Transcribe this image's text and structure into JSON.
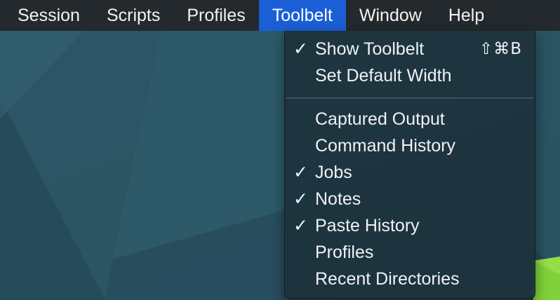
{
  "menubar": {
    "items": [
      {
        "label": "Session"
      },
      {
        "label": "Scripts"
      },
      {
        "label": "Profiles"
      },
      {
        "label": "Toolbelt",
        "active": true
      },
      {
        "label": "Window"
      },
      {
        "label": "Help"
      }
    ]
  },
  "toolbelt_menu": {
    "items": [
      {
        "label": "Show Toolbelt",
        "checked": true,
        "shortcut": "⇧⌘B"
      },
      {
        "label": "Set Default Width",
        "checked": false
      },
      {
        "label": "Captured Output",
        "checked": false
      },
      {
        "label": "Command History",
        "checked": false
      },
      {
        "label": "Jobs",
        "checked": true
      },
      {
        "label": "Notes",
        "checked": true
      },
      {
        "label": "Paste History",
        "checked": true
      },
      {
        "label": "Profiles",
        "checked": false
      },
      {
        "label": "Recent Directories",
        "checked": false
      }
    ],
    "check_glyph": "✓"
  },
  "colors": {
    "menubar_bg": "#24292d",
    "active_highlight": "#1a5fd6",
    "desktop_bg": "#2a5262",
    "menu_bg": "#1d333d",
    "accent_green": "#7fd23a"
  }
}
